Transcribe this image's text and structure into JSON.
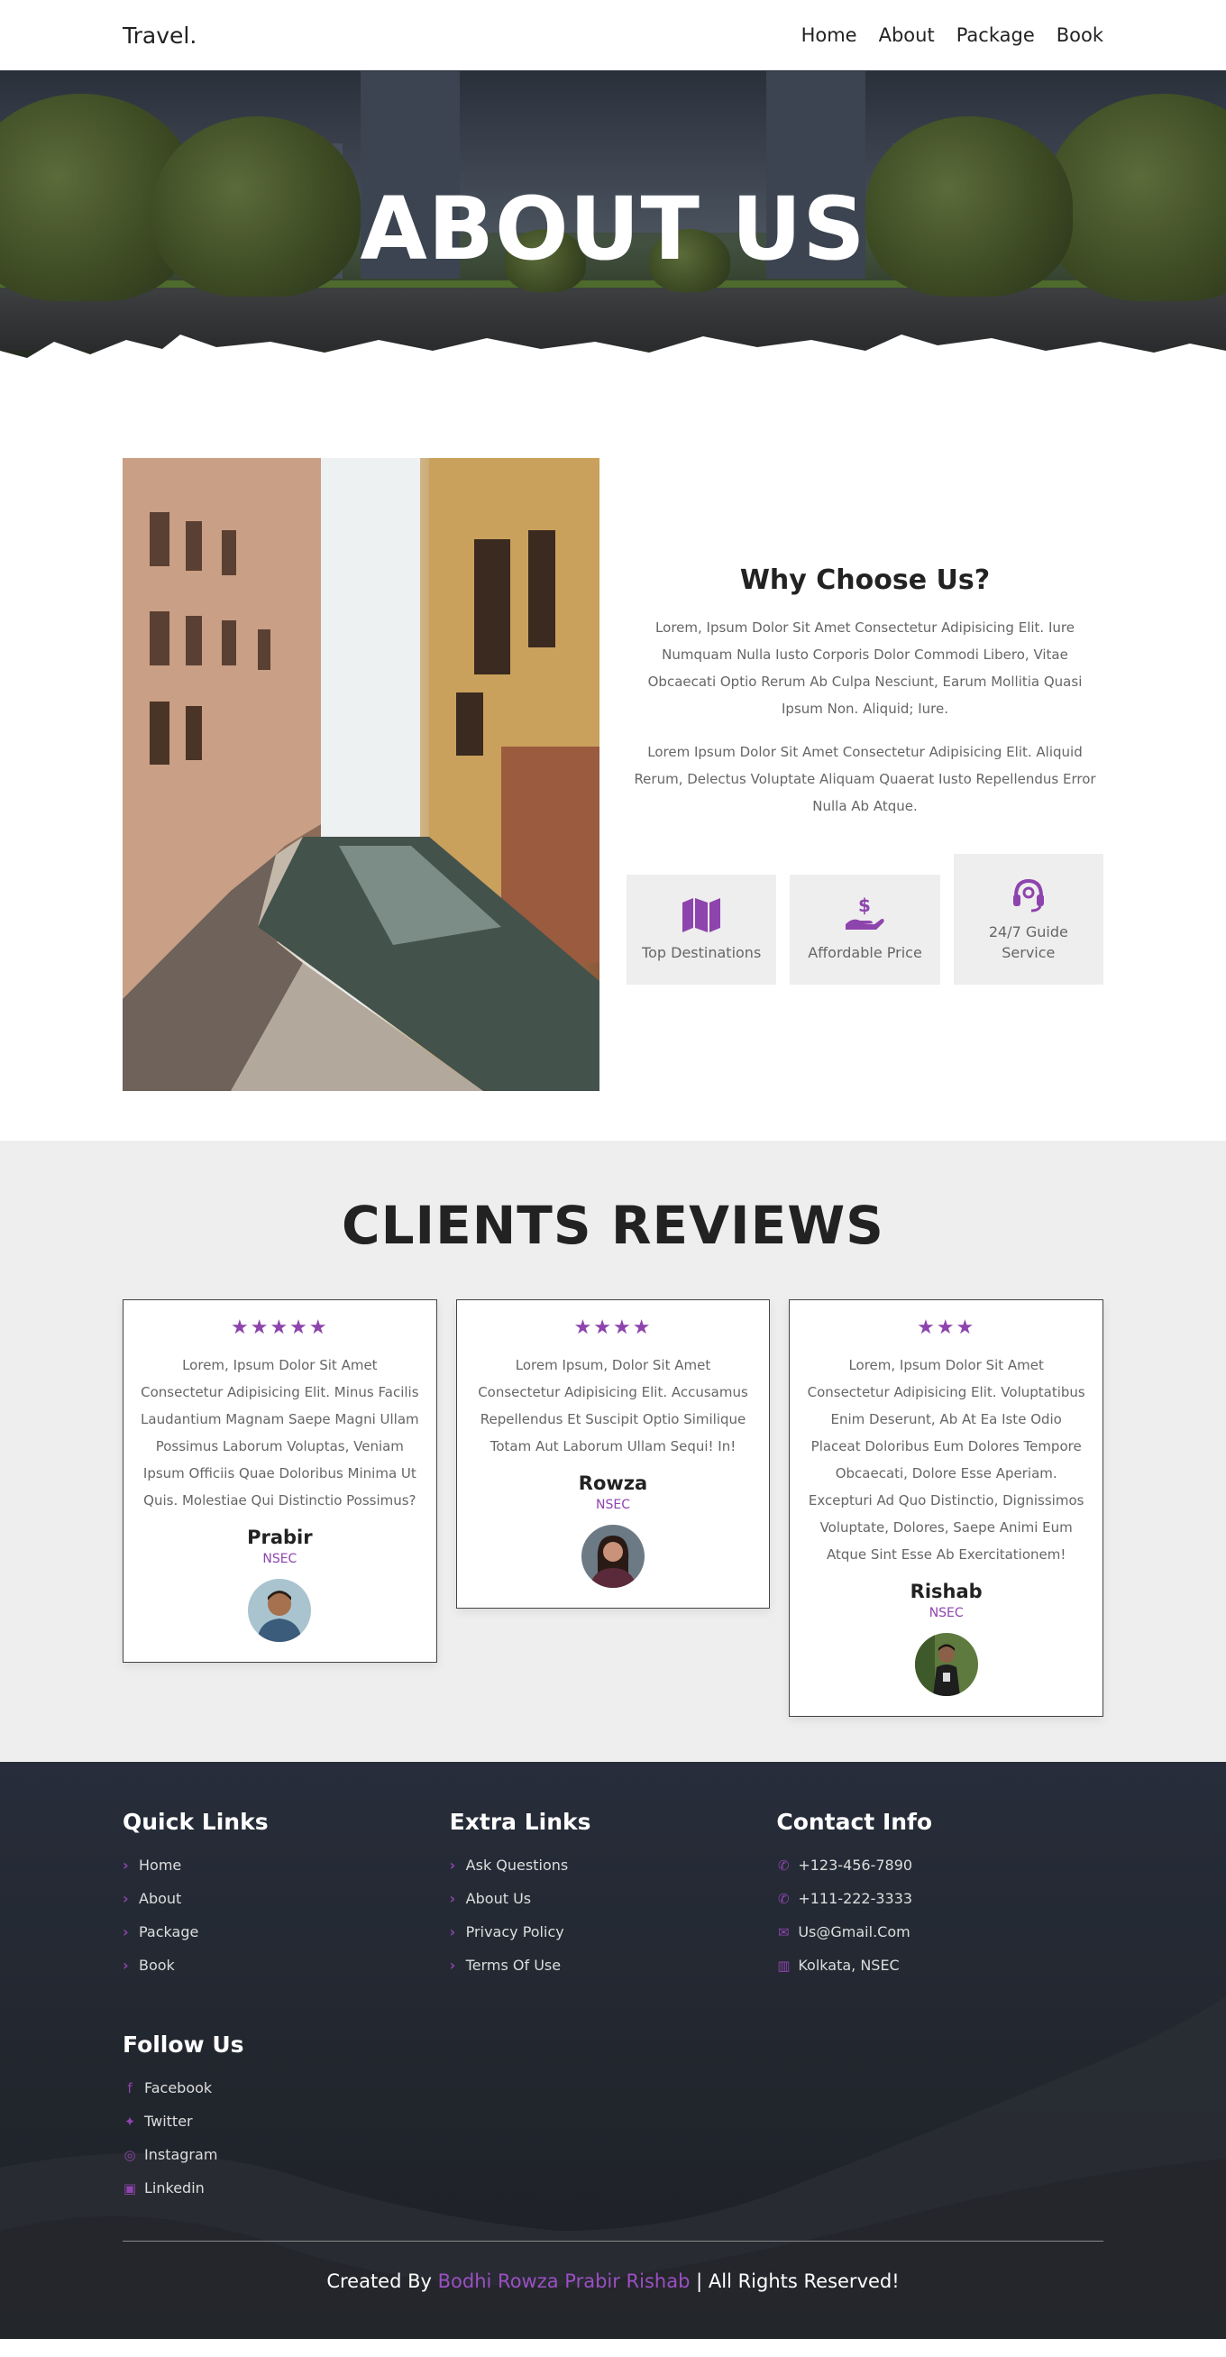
{
  "header": {
    "logo": "Travel.",
    "nav": [
      "Home",
      "About",
      "Package",
      "Book"
    ]
  },
  "hero": {
    "title": "ABOUT US"
  },
  "about": {
    "title": "Why Choose Us?",
    "paragraph1": "Lorem, Ipsum Dolor Sit Amet Consectetur Adipisicing Elit. Iure Numquam Nulla Iusto Corporis Dolor Commodi Libero, Vitae Obcaecati Optio Rerum Ab Culpa Nesciunt, Earum Mollitia Quasi Ipsum Non. Aliquid; Iure.",
    "paragraph2": "Lorem Ipsum Dolor Sit Amet Consectetur Adipisicing Elit. Aliquid Rerum, Delectus Voluptate Aliquam Quaerat Iusto Repellendus Error Nulla Ab Atque.",
    "features": [
      {
        "label": "Top Destinations",
        "icon": "map-icon"
      },
      {
        "label": "Affordable Price",
        "icon": "hand-dollar-icon"
      },
      {
        "label": "24/7 Guide Service",
        "icon": "headset-icon"
      }
    ]
  },
  "reviews": {
    "title": "CLIENTS REVIEWS",
    "items": [
      {
        "stars": "★★★★★",
        "text": "Lorem, Ipsum Dolor Sit Amet Consectetur Adipisicing Elit. Minus Facilis Laudantium Magnam Saepe Magni Ullam Possimus Laborum Voluptas, Veniam Ipsum Officiis Quae Doloribus Minima Ut Quis. Molestiae Qui Distinctio Possimus?",
        "name": "Prabir",
        "org": "NSEC"
      },
      {
        "stars": "★★★★",
        "text": "Lorem Ipsum, Dolor Sit Amet Consectetur Adipisicing Elit. Accusamus Repellendus Et Suscipit Optio Similique Totam Aut Laborum Ullam Sequi! In!",
        "name": "Rowza",
        "org": "NSEC"
      },
      {
        "stars": "★★★",
        "text": "Lorem, Ipsum Dolor Sit Amet Consectetur Adipisicing Elit. Voluptatibus Enim Deserunt, Ab At Ea Iste Odio Placeat Doloribus Eum Dolores Tempore Obcaecati, Dolore Esse Aperiam. Excepturi Ad Quo Distinctio, Dignissimos Voluptate, Dolores, Saepe Animi Eum Atque Sint Esse Ab Exercitationem!",
        "name": "Rishab",
        "org": "NSEC"
      }
    ]
  },
  "footer": {
    "quick": {
      "title": "Quick Links",
      "items": [
        "Home",
        "About",
        "Package",
        "Book"
      ]
    },
    "extra": {
      "title": "Extra Links",
      "items": [
        "Ask Questions",
        "About Us",
        "Privacy Policy",
        "Terms Of Use"
      ]
    },
    "contact": {
      "title": "Contact Info",
      "items": [
        "+123-456-7890",
        "+111-222-3333",
        "Us@Gmail.Com",
        "Kolkata, NSEC"
      ]
    },
    "follow": {
      "title": "Follow Us",
      "items": [
        "Facebook",
        "Twitter",
        "Instagram",
        "Linkedin"
      ]
    },
    "credit": {
      "prefix": "Created By",
      "names": "Bodhi Rowza Prabir Rishab",
      "suffix": "| All Rights Reserved!"
    }
  },
  "colors": {
    "accent": "#8e44ad",
    "footer_bg": "#22272f",
    "section_bg": "#eeeeee"
  }
}
